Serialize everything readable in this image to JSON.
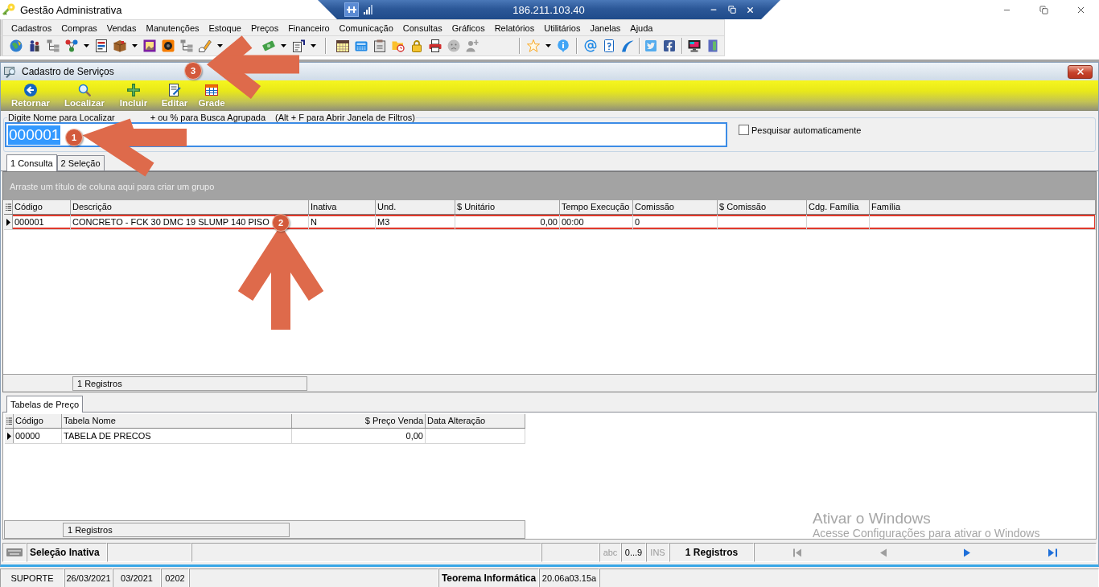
{
  "title_bar": {
    "title": "Gestão Administrativa"
  },
  "remote_bar": {
    "address": "186.211.103.40"
  },
  "menu": [
    {
      "label": "Cadastros"
    },
    {
      "label": "Compras"
    },
    {
      "label": "Vendas"
    },
    {
      "label": "Manutenções"
    },
    {
      "label": "Estoque"
    },
    {
      "label": "Preços"
    },
    {
      "label": "Financeiro"
    },
    {
      "label": "Comunicação"
    },
    {
      "label": "Consultas"
    },
    {
      "label": "Gráficos"
    },
    {
      "label": "Relatórios"
    },
    {
      "label": "Utilitários"
    },
    {
      "label": "Janelas"
    },
    {
      "label": "Ajuda"
    }
  ],
  "child_window": {
    "title": "Cadastro de Serviços"
  },
  "actions": [
    {
      "label": "Retornar"
    },
    {
      "label": "Localizar"
    },
    {
      "label": "Incluir"
    },
    {
      "label": "Editar"
    },
    {
      "label": "Grade"
    }
  ],
  "search": {
    "label_parts": [
      "Digite Nome para Localizar",
      "+ ou % para Busca Agrupada",
      "(Alt + F para Abrir Janela de Filtros)"
    ],
    "value": "000001",
    "value_selected": true
  },
  "auto_search": {
    "label": "Pesquisar automaticamente",
    "checked": false
  },
  "tabs": [
    {
      "label": "1 Consulta",
      "selected": true
    },
    {
      "label": "2 Seleção",
      "selected": false
    }
  ],
  "grid": {
    "group_hint": "Arraste um título de coluna aqui para criar um grupo",
    "columns": [
      {
        "label": "Código"
      },
      {
        "label": "Descrição"
      },
      {
        "label": "Inativa"
      },
      {
        "label": "Und."
      },
      {
        "label": "$ Unitário",
        "numeric": true
      },
      {
        "label": "Tempo Execução"
      },
      {
        "label": "Comissão"
      },
      {
        "label": "$ Comissão"
      },
      {
        "label": "Cdg. Família"
      },
      {
        "label": "Família"
      }
    ],
    "rows": [
      {
        "current": true,
        "highlighted": true,
        "cells": [
          "000001",
          "CONCRETO - FCK 30 DMC 19 SLUMP 140 PISO",
          "N",
          "M3",
          "0,00",
          "00:00",
          "0",
          null,
          null,
          null
        ]
      }
    ],
    "footer": "1 Registros"
  },
  "price_tables": {
    "tab": "Tabelas de Preço",
    "columns": [
      {
        "label": "Código"
      },
      {
        "label": "Tabela Nome"
      },
      {
        "label": "$ Preço Venda",
        "numeric": true
      },
      {
        "label": "Data Alteração"
      }
    ],
    "rows": [
      {
        "current": true,
        "highlighted": false,
        "cells": [
          "00000",
          "TABELA DE PRECOS",
          "0,00",
          null
        ]
      }
    ],
    "footer": "1 Registros"
  },
  "form_status": {
    "selection": "Seleção Inativa",
    "indicators": [
      {
        "label": "abc",
        "active": false
      },
      {
        "label": "0...9",
        "active": true
      },
      {
        "label": "INS",
        "active": false
      }
    ],
    "records": "1 Registros",
    "navigator": [
      {
        "kind": "first",
        "enabled": false
      },
      {
        "kind": "prior",
        "enabled": false
      },
      {
        "kind": "next",
        "enabled": true
      },
      {
        "kind": "last",
        "enabled": true
      }
    ]
  },
  "os_notice": {
    "title": "Ativar o Windows",
    "text": "Acesse Configurações para ativar o Windows"
  },
  "app_status": {
    "fields": [
      "SUPORTE",
      "26/03/2021",
      "03/2021",
      "0202"
    ],
    "company": "Teorema Informática",
    "version": "20.06a03.15a"
  },
  "annotations": [
    {
      "badge": "1",
      "kind": "left-arrow"
    },
    {
      "badge": "2",
      "kind": "up-arrow"
    },
    {
      "badge": "3",
      "kind": "left-arrow"
    }
  ]
}
